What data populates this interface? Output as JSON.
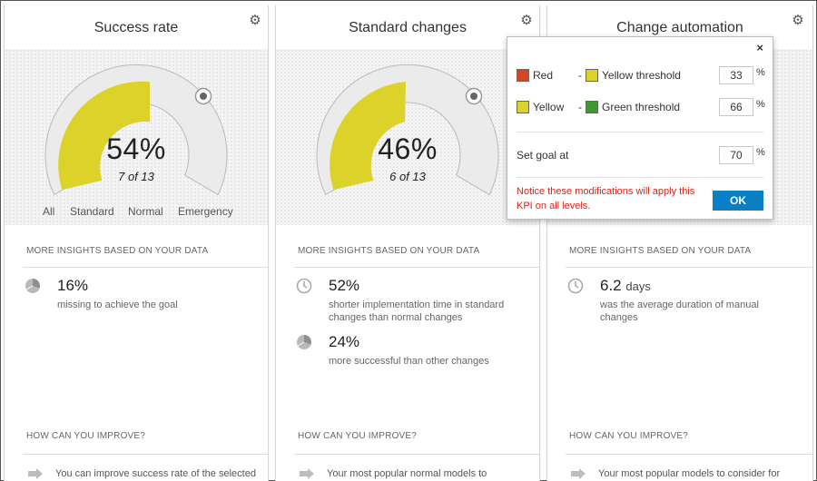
{
  "colors": {
    "yellow": "#dcd22a",
    "red": "#d54521",
    "green": "#3a9a2d",
    "ok_button": "#0a7fc4",
    "notice": "#d8261c"
  },
  "cards": [
    {
      "title": "Success rate",
      "gauge": {
        "percent_label": "54%",
        "fraction_label": "7 of 13",
        "value": 0.54
      },
      "filters": [
        "All",
        "Standard",
        "Normal",
        "Emergency"
      ],
      "insights_heading": "MORE INSIGHTS BASED ON YOUR DATA",
      "insights": [
        {
          "icon": "pie-chart-icon",
          "value": "16%",
          "unit": "",
          "description": "missing to achieve the goal"
        }
      ],
      "improve_heading": "HOW CAN YOU IMPROVE?",
      "improve_text": "You can improve success rate of the selected"
    },
    {
      "title": "Standard changes",
      "gauge": {
        "percent_label": "46%",
        "fraction_label": "6 of 13",
        "value": 0.46
      },
      "insights_heading": "MORE INSIGHTS BASED ON YOUR DATA",
      "insights": [
        {
          "icon": "clock-icon",
          "value": "52%",
          "unit": "",
          "description": "shorter implementation time in standard changes than normal changes"
        },
        {
          "icon": "pie-chart-icon",
          "value": "24%",
          "unit": "",
          "description": "more successful than other changes"
        }
      ],
      "improve_heading": "HOW CAN YOU IMPROVE?",
      "improve_text": "Your most popular normal models to"
    },
    {
      "title": "Change automation",
      "insights_heading": "MORE INSIGHTS BASED ON YOUR DATA",
      "insights": [
        {
          "icon": "clock-icon",
          "value": "6.2",
          "unit": "days",
          "description": "was the average duration of manual changes"
        }
      ],
      "improve_heading": "HOW CAN YOU IMPROVE?",
      "improve_text": "Your most popular models to consider for"
    }
  ],
  "popup": {
    "close_label": "×",
    "red_label": "Red",
    "dash1": "-",
    "yellow_threshold_label": "Yellow threshold",
    "yellow_threshold_value": "33",
    "yellow_label": "Yellow",
    "dash2": "-",
    "green_threshold_label": "Green threshold",
    "green_threshold_value": "66",
    "goal_label": "Set goal at",
    "goal_value": "70",
    "percent_sign": "%",
    "notice": "Notice these modifications will apply this KPI on all levels.",
    "ok_label": "OK"
  }
}
